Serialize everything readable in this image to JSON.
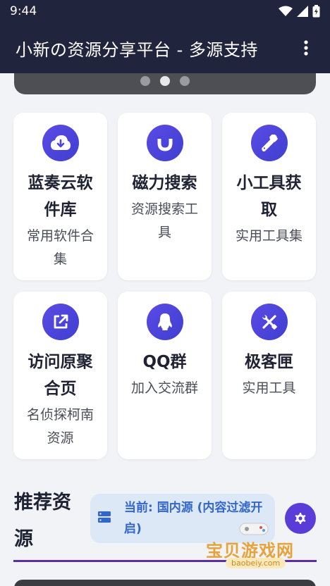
{
  "status_bar": {
    "time": "9:44"
  },
  "app_bar": {
    "title": "小新の资源分享平台 - 多源支持"
  },
  "carousel": {
    "dot_count": 3,
    "active_index": 1
  },
  "cards": [
    {
      "title": "蓝奏云软件库",
      "desc": "常用软件合集",
      "icon": "cloud-download-icon"
    },
    {
      "title": "磁力搜索",
      "desc": "资源搜索工具",
      "icon": "magnet-icon"
    },
    {
      "title": "小工具获取",
      "desc": "实用工具集",
      "icon": "wrench-icon"
    },
    {
      "title": "访问原聚合页",
      "desc": "名侦探柯南资源",
      "icon": "external-link-icon"
    },
    {
      "title": "QQ群",
      "desc": "加入交流群",
      "icon": "qq-icon"
    },
    {
      "title": "极客匣",
      "desc": "实用工具",
      "icon": "tools-icon"
    }
  ],
  "recommend": {
    "title": "推荐资源",
    "source_label": "当前: 国内源 (内容过滤开启)"
  },
  "watermark": {
    "title": "宝贝游戏网",
    "url": "baobeiy.com"
  },
  "colors": {
    "app_bar": "#21243d",
    "accent": "#4a43df",
    "source_text": "#3366cc"
  }
}
